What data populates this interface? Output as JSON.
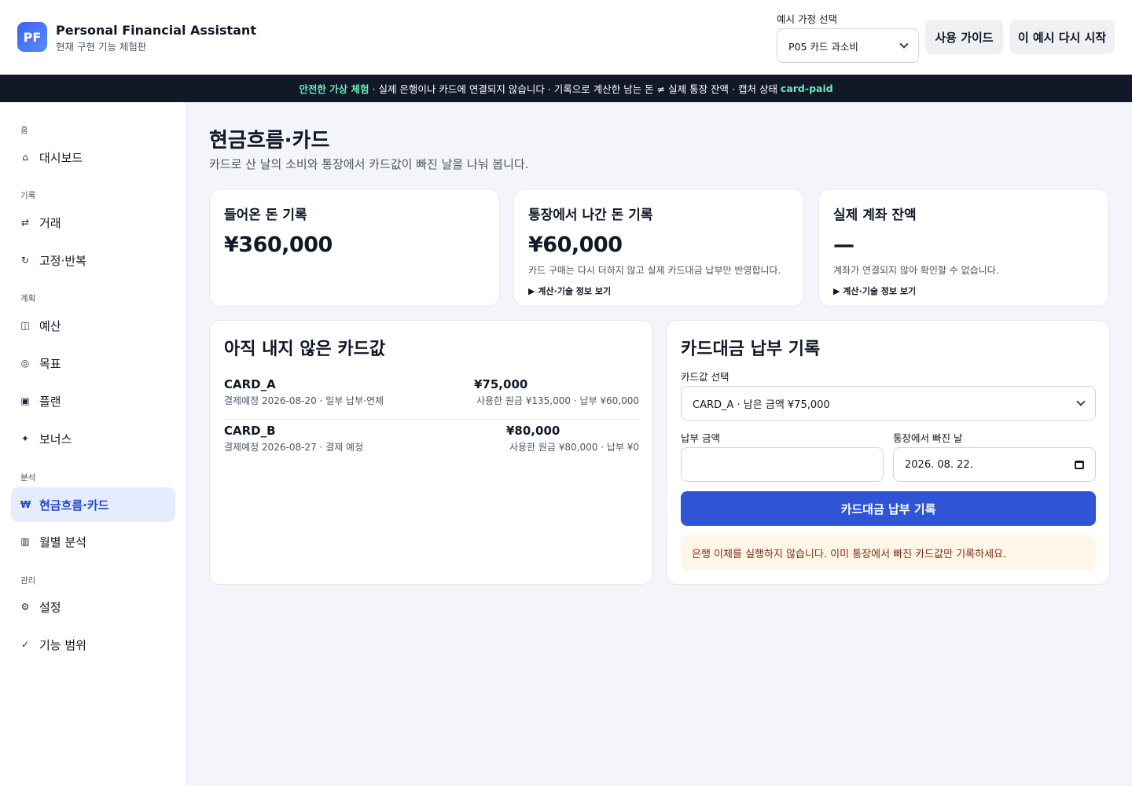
{
  "app": {
    "logo": "PF",
    "title": "Personal Financial Assistant",
    "subtitle": "현재 구현 기능 체험판"
  },
  "header": {
    "scenario_label": "예시 가정 선택",
    "scenario_value": "P05 카드 과소비",
    "guide_button": "사용 가이드",
    "restart_button": "이 예시 다시 시작"
  },
  "banner": {
    "highlight": "안전한 가상 체험",
    "text": " · 실제 은행이나 카드에 연결되지 않습니다 · 기록으로 계산한 남는 돈 ≠ 실제 통장 잔액 · 캡처 상태 ",
    "status": "card-paid"
  },
  "sidebar": {
    "sections": [
      "홈",
      "기록",
      "계획",
      "분석",
      "관리"
    ],
    "items": [
      {
        "icon": "⌂",
        "icon_name": "home-icon",
        "label": "대시보드"
      },
      {
        "icon": "⇄",
        "icon_name": "transfer-icon",
        "label": "거래"
      },
      {
        "icon": "↻",
        "icon_name": "repeat-icon",
        "label": "고정·반복"
      },
      {
        "icon": "◫",
        "icon_name": "budget-icon",
        "label": "예산"
      },
      {
        "icon": "◎",
        "icon_name": "target-icon",
        "label": "목표"
      },
      {
        "icon": "▣",
        "icon_name": "plan-icon",
        "label": "플랜"
      },
      {
        "icon": "✦",
        "icon_name": "sparkle-icon",
        "label": "보너스"
      },
      {
        "icon": "₩",
        "icon_name": "won-icon",
        "label": "현금흐름·카드"
      },
      {
        "icon": "▥",
        "icon_name": "bar-chart-icon",
        "label": "월별 분석"
      },
      {
        "icon": "⚙",
        "icon_name": "gear-icon",
        "label": "설정"
      },
      {
        "icon": "✓",
        "icon_name": "check-icon",
        "label": "기능 범위"
      }
    ]
  },
  "page": {
    "title": "현금흐름·카드",
    "subtitle": "카드로 산 날의 소비와 통장에서 카드값이 빠진 날을 나눠 봅니다."
  },
  "kpis": [
    {
      "title": "들어온 돈 기록",
      "value": "¥360,000",
      "note": "",
      "more": ""
    },
    {
      "title": "통장에서 나간 돈 기록",
      "value": "¥60,000",
      "note": "카드 구매는 다시 더하지 않고 실제 카드대금 납부만 반영합니다.",
      "more": "▶ 계산·기술 정보 보기"
    },
    {
      "title": "실제 계좌 잔액",
      "value": "—",
      "note": "계좌가 연결되지 않아 확인할 수 없습니다.",
      "more": "▶ 계산·기술 정보 보기"
    }
  ],
  "unpaid": {
    "title": "아직 내지 않은 카드값",
    "cards": [
      {
        "name": "CARD_A",
        "desc": "결제예정 2026-08-20 · 일부 납부·연체",
        "amount": "¥75,000",
        "detail": "사용한 원금 ¥135,000 · 납부 ¥60,000"
      },
      {
        "name": "CARD_B",
        "desc": "결제예정 2026-08-27 · 결제 예정",
        "amount": "¥80,000",
        "detail": "사용한 원금 ¥80,000 · 납부 ¥0"
      }
    ]
  },
  "payment": {
    "title": "카드대금 납부 기록",
    "select_label": "카드값 선택",
    "select_value": "CARD_A · 남은 금액 ¥75,000",
    "amount_label": "납부 금액",
    "amount_value": "",
    "date_label": "통장에서 빠진 날",
    "date_value": "2026. 08. 22.",
    "submit": "카드대금 납부 기록",
    "notice": "은행 이체를 실행하지 않습니다. 이미 통장에서 빠진 카드값만 기록하세요."
  }
}
